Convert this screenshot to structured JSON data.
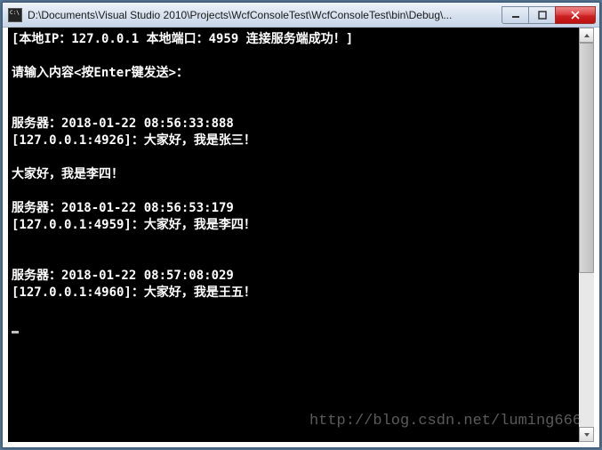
{
  "window": {
    "title": "D:\\Documents\\Visual Studio 2010\\Projects\\WcfConsoleTest\\WcfConsoleTest\\bin\\Debug\\..."
  },
  "console": {
    "header_line": "[本地IP：127.0.0.1 本地端口：4959 连接服务端成功！]",
    "prompt": "请输入内容<按Enter键发送>：",
    "messages": [
      {
        "server_line": "服务器：2018-01-22 08:56:33:888",
        "client_line": "[127.0.0.1:4926]：大家好，我是张三！"
      },
      {
        "input_echo": "大家好，我是李四！",
        "server_line": "服务器：2018-01-22 08:56:53:179",
        "client_line": "[127.0.0.1:4959]：大家好，我是李四！"
      },
      {
        "server_line": "服务器：2018-01-22 08:57:08:029",
        "client_line": "[127.0.0.1:4960]：大家好，我是王五！"
      }
    ]
  },
  "watermark": "http://blog.csdn.net/luming666"
}
